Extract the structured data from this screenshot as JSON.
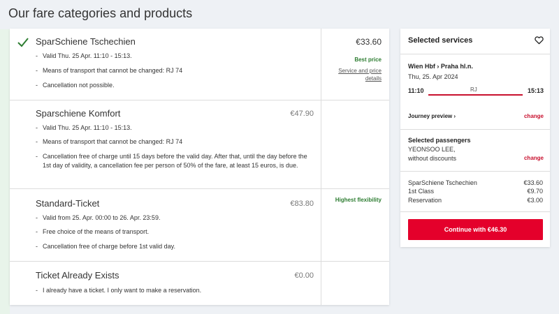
{
  "page": {
    "title": "Our fare categories and products"
  },
  "products": [
    {
      "name": "SparSchiene Tschechien",
      "price": "€33.60",
      "selected": true,
      "tag": "Best price",
      "service_link": "Service and price details",
      "bullets": [
        "Valid Thu. 25 Apr. 11:10 - 15:13.",
        "Means of transport that cannot be changed: RJ 74",
        "Cancellation not possible."
      ]
    },
    {
      "name": "Sparschiene Komfort",
      "price": "€47.90",
      "selected": false,
      "bullets": [
        "Valid Thu. 25 Apr. 11:10 - 15:13.",
        "Means of transport that cannot be changed: RJ 74",
        "Cancellation free of charge until 15 days before the valid day. After that, until the day before the 1st day of validity, a cancellation fee per person of 50% of the fare, at least 15 euros, is due."
      ]
    },
    {
      "name": "Standard-Ticket",
      "price": "€83.80",
      "selected": false,
      "tag": "Highest flexibility",
      "bullets": [
        "Valid from 25. Apr. 00:00 to 26. Apr. 23:59.",
        "Free choice of the means of transport.",
        "Cancellation free of charge before 1st valid day."
      ]
    },
    {
      "name": "Ticket Already Exists",
      "price": "€0.00",
      "selected": false,
      "bullets": [
        "I already have a ticket. I only want to make a reservation."
      ]
    }
  ],
  "sidebar": {
    "title": "Selected services",
    "route": "Wien Hbf › Praha hl.n.",
    "date": "Thu, 25. Apr 2024",
    "departure": "11:10",
    "arrival": "15:13",
    "train": "RJ",
    "journey_link": "Journey preview ›",
    "change_label": "change",
    "passengers_title": "Selected passengers",
    "passenger_name": "YEONSOO LEE,",
    "passenger_discount": "without discounts",
    "items": [
      {
        "label": "SparSchiene Tschechien",
        "price": "€33.60"
      },
      {
        "label": "1st Class",
        "price": "€9.70"
      },
      {
        "label": "Reservation",
        "price": "€3.00"
      }
    ],
    "continue_label": "Continue with €46.30"
  },
  "colors": {
    "accent": "#e4002b",
    "check": "#2e7d32",
    "train_bar": "#c8102e"
  },
  "icons": {
    "check": "check-icon",
    "heart": "heart-icon"
  }
}
